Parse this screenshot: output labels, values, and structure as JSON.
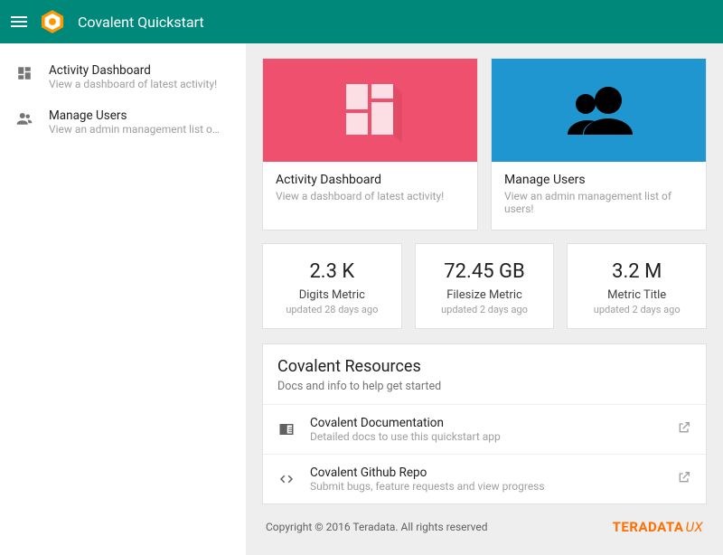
{
  "header": {
    "title": "Covalent Quickstart"
  },
  "sidebar": {
    "items": [
      {
        "title": "Activity Dashboard",
        "subtitle": "View a dashboard of latest activity!"
      },
      {
        "title": "Manage Users",
        "subtitle": "View an admin management list of use.."
      }
    ]
  },
  "cards": [
    {
      "title": "Activity Dashboard",
      "subtitle": "View a dashboard of latest activity!"
    },
    {
      "title": "Manage Users",
      "subtitle": "View an admin management list of users!"
    }
  ],
  "metrics": [
    {
      "value": "2.3 K",
      "name": "Digits Metric",
      "updated": "updated 28 days ago"
    },
    {
      "value": "72.45 GB",
      "name": "Filesize Metric",
      "updated": "updated 2 days ago"
    },
    {
      "value": "3.2 M",
      "name": "Metric Title",
      "updated": "updated 2 days ago"
    }
  ],
  "resources": {
    "title": "Covalent Resources",
    "subtitle": "Docs and info to help get started",
    "items": [
      {
        "title": "Covalent Documentation",
        "subtitle": "Detailed docs to use this quickstart app"
      },
      {
        "title": "Covalent Github Repo",
        "subtitle": "Submit bugs, feature requests and view progress"
      }
    ]
  },
  "footer": {
    "copyright": "Copyright © 2016 Teradata. All rights reserved",
    "brand": "TERADATA",
    "brand_suffix": "UX"
  }
}
